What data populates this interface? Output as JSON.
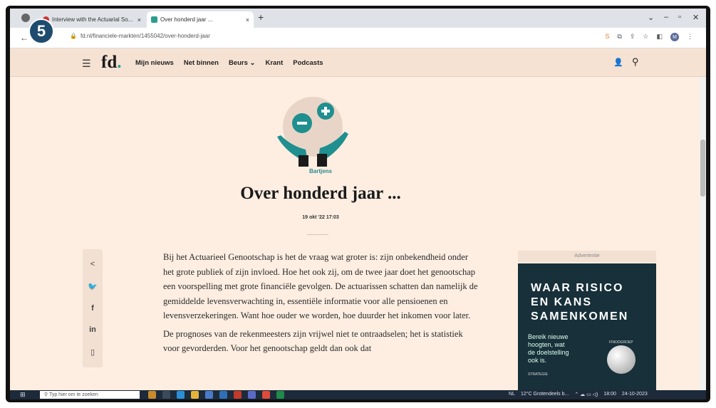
{
  "step_badge": "5",
  "browser": {
    "tabs": [
      {
        "label": "Interview with the Actuarial So...",
        "close": "×"
      },
      {
        "label": "Over honderd jaar ...",
        "close": "×"
      }
    ],
    "new_tab": "+",
    "url": "fd.nl/financiele-markten/1455042/over-honderd-jaar",
    "profile_initial": "M"
  },
  "site": {
    "logo_main": "fd",
    "logo_dot": ".",
    "nav": [
      "Mijn nieuws",
      "Net binnen",
      "Beurs ⌄",
      "Krant",
      "Podcasts"
    ]
  },
  "article": {
    "category": "Bartjens",
    "title": "Over honderd jaar ...",
    "date": "19 okt '22  17:03",
    "paragraphs": [
      "Bij het Actuarieel Genootschap is het de vraag wat groter is: zijn onbekendheid onder het grote publiek of zijn invloed. Hoe het ook zij, om de twee jaar doet het genootschap een voorspelling met grote financiële gevolgen. De actuarissen schatten dan namelijk de gemiddelde levensverwachting in, essentiële informatie voor alle pensioenen en levensverzekeringen. Want hoe ouder we worden, hoe duurder het inkomen voor later.",
      "De prognoses van de rekenmeesters zijn vrijwel niet te ontraadselen; het is statistiek voor gevorderden. Voor het genootschap geldt dan ook dat"
    ]
  },
  "share_icons": [
    "share-icon",
    "twitter-icon",
    "facebook-icon",
    "linkedin-icon",
    "bookmark-icon"
  ],
  "ad": {
    "label": "Advertentie",
    "headline": [
      "WAAR RISICO",
      "EN KANS",
      "SAMENKOMEN"
    ],
    "sub": [
      "Bereik nieuwe",
      "hoogten, wat",
      "de doelstelling",
      "ook is."
    ],
    "tag1": "FINODGROEP",
    "tag2": "STRATEGIE"
  },
  "taskbar": {
    "search_placeholder": "Typ hier om te zoeken",
    "lang": "NL",
    "weather": "12°C  Grotendeels b...",
    "time": "18:00",
    "date": "24-10-2023"
  }
}
